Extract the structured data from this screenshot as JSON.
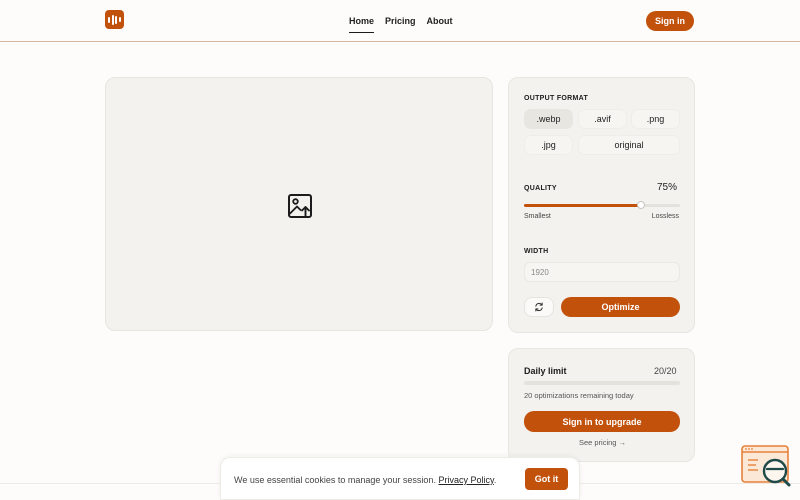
{
  "header": {
    "logo_icon": "bar-chart-logo-icon",
    "nav": [
      {
        "label": "Home",
        "active": true
      },
      {
        "label": "Pricing",
        "active": false
      },
      {
        "label": "About",
        "active": false
      }
    ],
    "signin_label": "Sign in"
  },
  "dropzone": {
    "icon": "image-upload-icon"
  },
  "settings": {
    "output_format_label": "OUTPUT FORMAT",
    "formats": [
      ".webp",
      ".avif",
      ".png",
      ".jpg",
      "original"
    ],
    "selected_format": ".webp",
    "quality_label": "QUALITY",
    "quality_value": "75%",
    "quality_fraction": 0.75,
    "quality_min_label": "Smallest",
    "quality_max_label": "Lossless",
    "width_label": "WIDTH",
    "width_placeholder": "1920",
    "reset_icon": "refresh-icon",
    "optimize_label": "Optimize"
  },
  "limit": {
    "title": "Daily limit",
    "count": "20/20",
    "used_fraction": 0,
    "subtext": "20 optimizations remaining today",
    "upgrade_label": "Sign in to upgrade",
    "see_pricing": "See pricing →"
  },
  "cookie": {
    "text": "We use essential cookies to manage your session.",
    "link": "Privacy Policy",
    "suffix": ".",
    "button": "Got it"
  },
  "widget": {
    "icon": "search-inspect-widget-icon"
  },
  "colors": {
    "accent": "#c2510c",
    "panel_bg": "#f3f2ee",
    "page_bg": "#fdfcfa",
    "widget_accent": "#e8803a",
    "widget_dark": "#1f4a4a"
  }
}
